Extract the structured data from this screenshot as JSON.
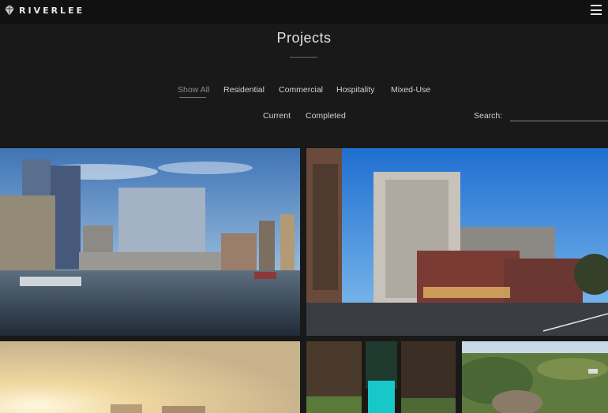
{
  "header": {
    "brand": "RIVERLEE",
    "logo_icon": "diamond-logo-icon",
    "menu_icon": "hamburger-menu-icon"
  },
  "page": {
    "title": "Projects"
  },
  "category_filters": {
    "show_all": "Show All",
    "residential": "Residential",
    "commercial": "Commercial",
    "hospitality": "Hospitality",
    "mixed_use": "Mixed-Use",
    "active": "Show All"
  },
  "status_filters": {
    "current": "Current",
    "completed": "Completed"
  },
  "search": {
    "label": "Search:",
    "value": ""
  },
  "colors": {
    "background": "#191919",
    "topbar": "#111111",
    "text": "#d2d2d2",
    "active_filter": "#8c8c8c"
  },
  "projects": [
    {
      "image": "waterfront-office-towers-photo"
    },
    {
      "image": "residential-apartment-building-photo"
    },
    {
      "image": "city-skyline-sunset-photo"
    },
    {
      "image": "courtyard-pool-night-photo"
    },
    {
      "image": "aerial-park-development-photo"
    }
  ]
}
